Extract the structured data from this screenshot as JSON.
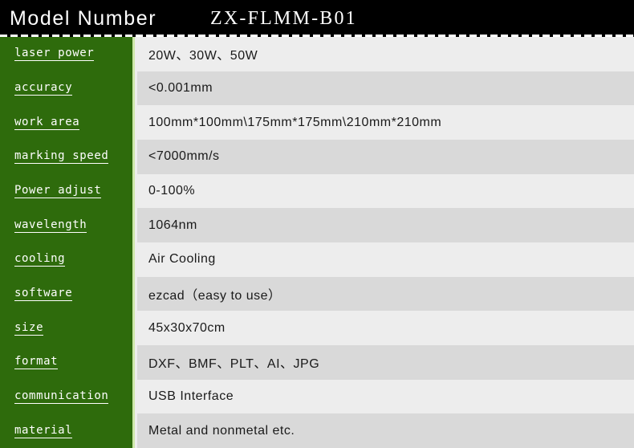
{
  "header": {
    "title": "Model Number",
    "model_number": "ZX-FLMM-B01"
  },
  "colors": {
    "header_bg": "#000000",
    "label_column_bg": "#2e6b0c",
    "label_divider": "#cde8a8",
    "row_bg_light": "#ededed",
    "row_bg_dark": "#d9d9d9",
    "label_text": "#ffffff",
    "value_text": "#1a1a1a"
  },
  "table": {
    "columns": [
      "Model Number",
      "ZX-FLMM-B01"
    ],
    "rows": [
      {
        "label": "laser power",
        "value": "20W、30W、50W"
      },
      {
        "label": "accuracy",
        "value": "<0.001mm"
      },
      {
        "label": "work area",
        "value": "100mm*100mm\\175mm*175mm\\210mm*210mm"
      },
      {
        "label": "marking speed",
        "value": "<7000mm/s"
      },
      {
        "label": "Power adjust",
        "value": "0-100%"
      },
      {
        "label": "wavelength",
        "value": "1064nm"
      },
      {
        "label": "cooling",
        "value": "Air Cooling"
      },
      {
        "label": "software",
        "value": "ezcad（easy to use）"
      },
      {
        "label": "size",
        "value": "45x30x70cm"
      },
      {
        "label": "format",
        "value": "DXF、BMF、PLT、AI、JPG"
      },
      {
        "label": "communication",
        "value": "USB Interface"
      },
      {
        "label": "material",
        "value": "Metal and nonmetal etc."
      }
    ]
  }
}
